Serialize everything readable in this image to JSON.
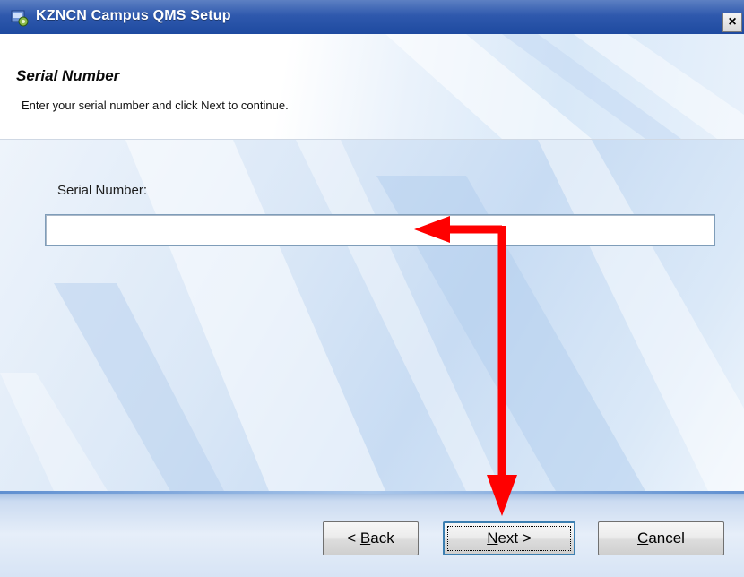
{
  "window": {
    "title": "KZNCN Campus QMS Setup",
    "close_glyph": "×"
  },
  "header": {
    "title": "Serial Number",
    "subtitle": "Enter your serial number and click Next to continue."
  },
  "form": {
    "serial_label": "Serial Number:",
    "serial_value": "",
    "serial_placeholder": ""
  },
  "buttons": {
    "back_prefix": "< ",
    "back_accel": "B",
    "back_rest": "ack",
    "next_accel": "N",
    "next_rest": "ext >",
    "cancel_accel": "C",
    "cancel_rest": "ancel"
  },
  "colors": {
    "annotation_arrow": "#ff0000",
    "title_bar": "#2f59ad"
  },
  "icons": {
    "app": "setup-installer-icon",
    "close": "close-icon"
  }
}
